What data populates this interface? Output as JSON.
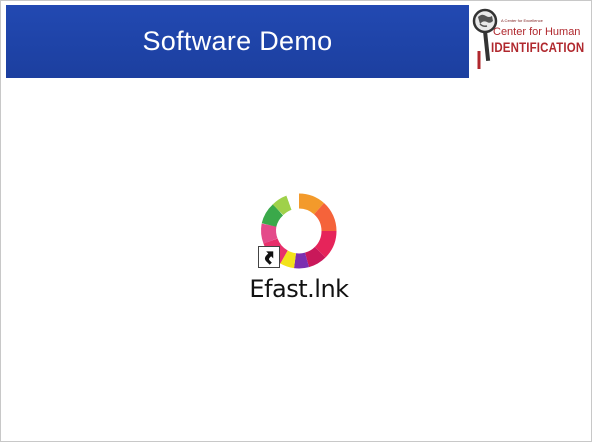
{
  "slide": {
    "title": "Software Demo"
  },
  "logo": {
    "small_text": "A Center for Excellence",
    "line1": "Center for Human",
    "line2": "IDENTIFICATION"
  },
  "desktop": {
    "shortcut": {
      "label": "Efast.lnk",
      "icon": "efast-color-ring-icon",
      "overlay_icon": "shortcut-arrow-icon"
    }
  },
  "colors": {
    "title_bar": "#1e42a8",
    "title_text": "#ffffff",
    "logo_text": "#b0282e"
  }
}
